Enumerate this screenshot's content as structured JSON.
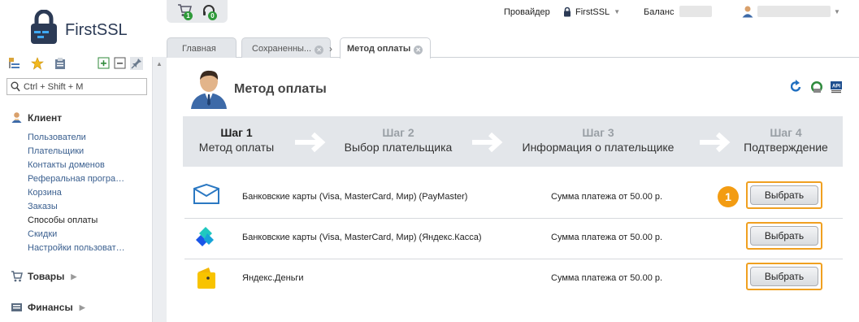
{
  "app": {
    "logo_text": "FirstSSL"
  },
  "header": {
    "cart_count": "1",
    "support_count": "0",
    "provider_label": "Провайдер",
    "provider_name": "FirstSSL",
    "balance_label": "Баланс"
  },
  "sidebar": {
    "search_placeholder": "Ctrl + Shift + M",
    "client_section": "Клиент",
    "client_items": [
      "Пользователи",
      "Плательщики",
      "Контакты доменов",
      "Реферальная програ…",
      "Корзина",
      "Заказы",
      "Способы оплаты",
      "Скидки",
      "Настройки пользоват…"
    ],
    "goods_section": "Товары",
    "finance_section": "Финансы"
  },
  "tabs": [
    {
      "label": "Главная"
    },
    {
      "label": "Сохраненны..."
    },
    {
      "label": "Метод оплаты"
    }
  ],
  "page": {
    "title": "Метод оплаты"
  },
  "steps": [
    {
      "number": "Шаг 1",
      "title": "Метод оплаты"
    },
    {
      "number": "Шаг 2",
      "title": "Выбор плательщика"
    },
    {
      "number": "Шаг 3",
      "title": "Информация о плательщике"
    },
    {
      "number": "Шаг 4",
      "title": "Подтверждение"
    }
  ],
  "methods": [
    {
      "name": "Банковские карты (Visa, MasterCard, Мир) (PayMaster)",
      "sum": "Сумма платежа от 50.00 р.",
      "button": "Выбрать"
    },
    {
      "name": "Банковские карты (Visa, MasterCard, Мир) (Яндекс.Касса)",
      "sum": "Сумма платежа от 50.00 р.",
      "button": "Выбрать"
    },
    {
      "name": "Яндекс.Деньги",
      "sum": "Сумма платежа от 50.00 р.",
      "button": "Выбрать"
    }
  ],
  "callout": "1",
  "colors": {
    "accent": "#f39c12",
    "steps_bg": "#e3e6ea",
    "link": "#3a5f8f"
  }
}
